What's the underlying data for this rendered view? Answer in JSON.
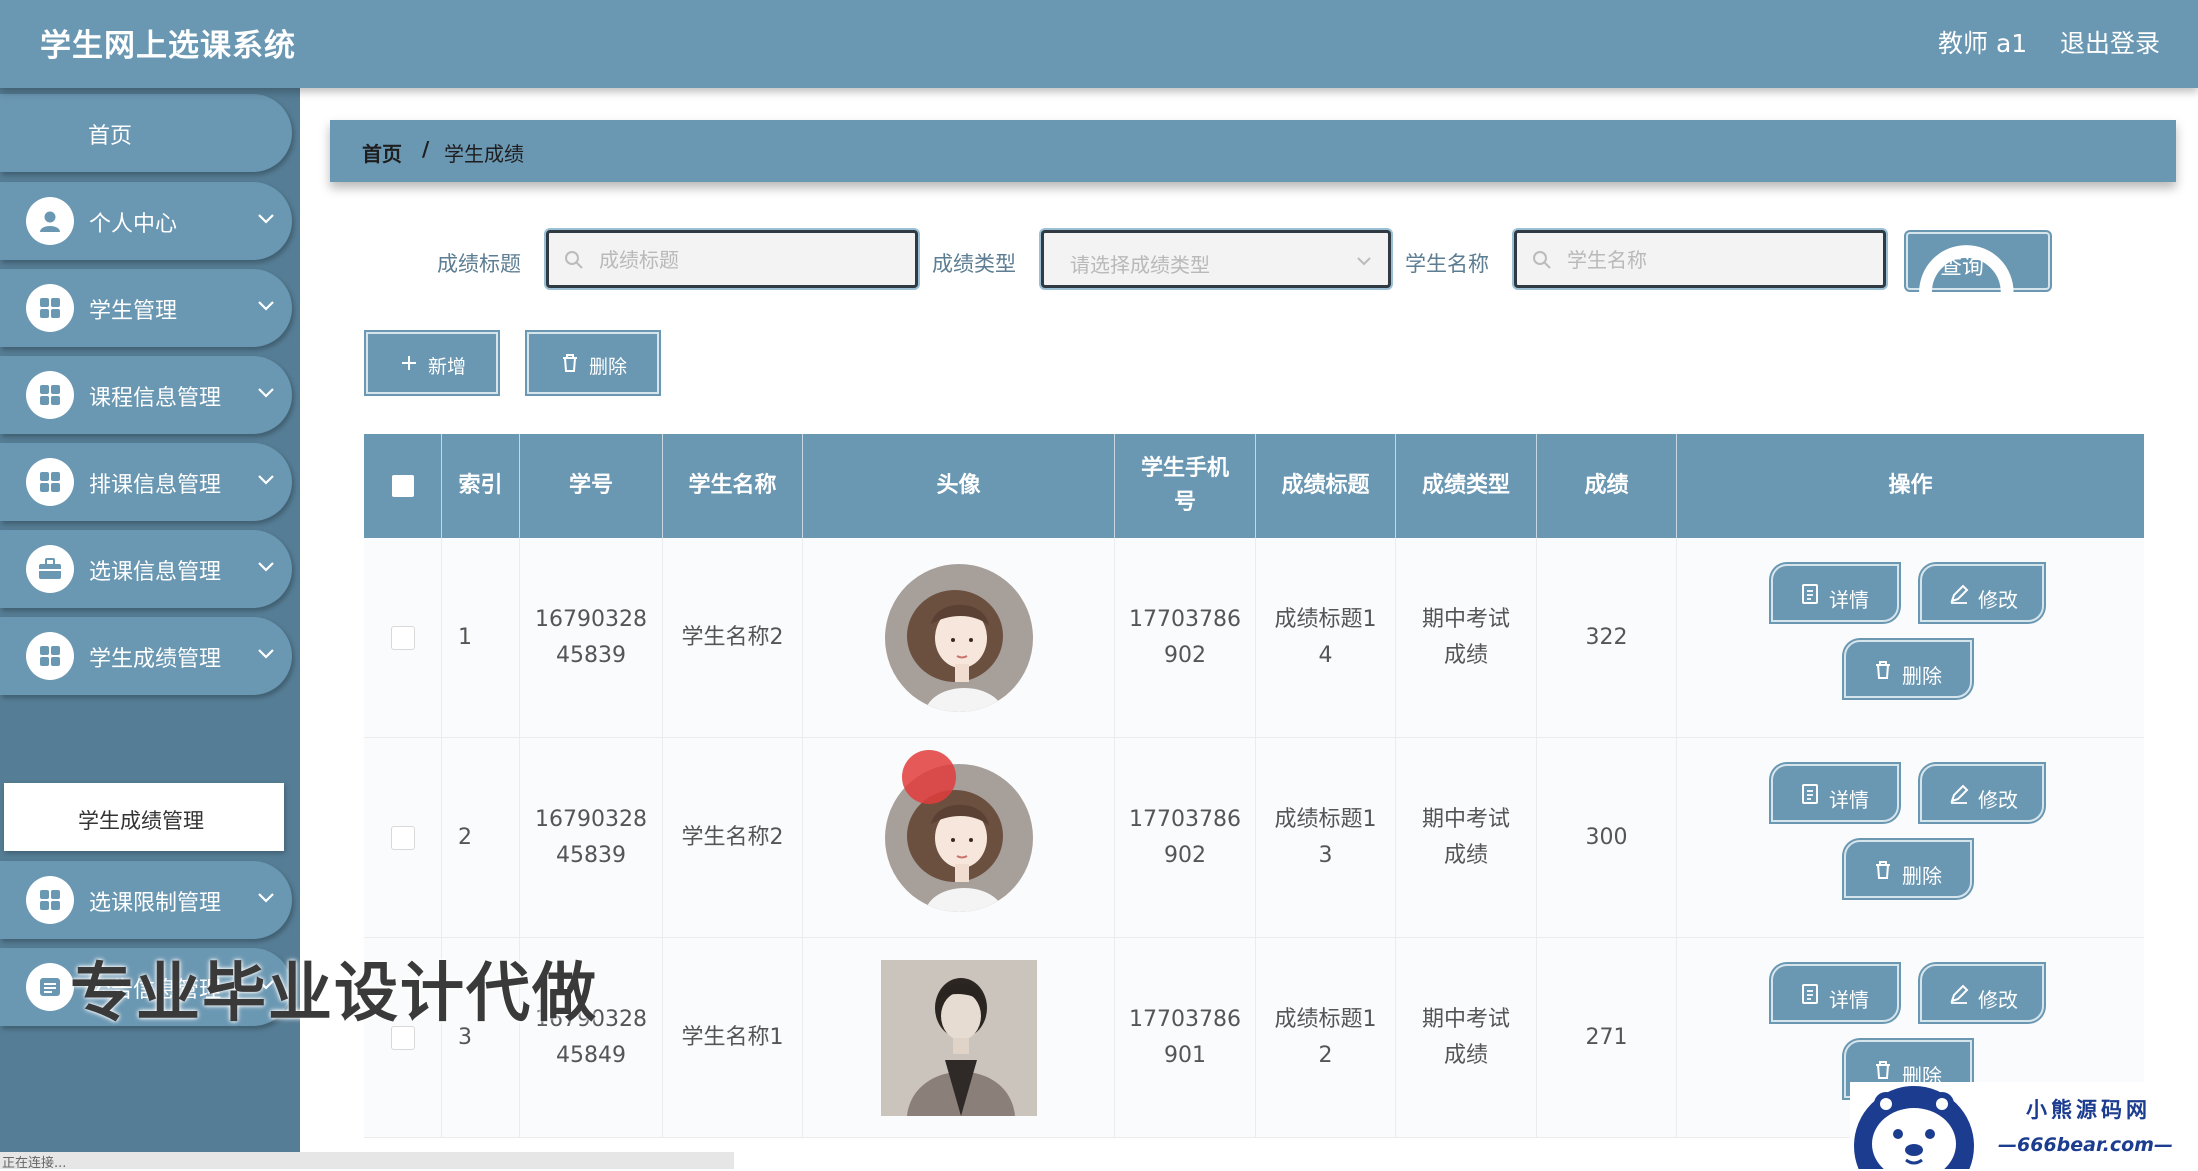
{
  "header": {
    "app_title": "学生网上选课系统",
    "user_label": "教师 a1",
    "logout_label": "退出登录"
  },
  "sidebar": {
    "home_label": "首页",
    "items": [
      {
        "label": "个人中心",
        "icon": "user-icon"
      },
      {
        "label": "学生管理",
        "icon": "grid-icon"
      },
      {
        "label": "课程信息管理",
        "icon": "grid-icon"
      },
      {
        "label": "排课信息管理",
        "icon": "grid-icon"
      },
      {
        "label": "选课信息管理",
        "icon": "briefcase-icon"
      },
      {
        "label": "学生成绩管理",
        "icon": "grid-icon"
      },
      {
        "label": "选课限制管理",
        "icon": "grid-icon"
      },
      {
        "label": "公告信息管理",
        "icon": "list-icon"
      }
    ],
    "active_submenu": "学生成绩管理"
  },
  "breadcrumb": {
    "home": "首页",
    "separator": "/",
    "current": "学生成绩"
  },
  "filters": {
    "score_title_label": "成绩标题",
    "score_title_placeholder": "成绩标题",
    "score_type_label": "成绩类型",
    "score_type_placeholder": "请选择成绩类型",
    "student_name_label": "学生名称",
    "student_name_placeholder": "学生名称",
    "query_label": "查询"
  },
  "actions": {
    "add_label": "新增",
    "delete_label": "删除"
  },
  "table": {
    "columns": [
      "",
      "索引",
      "学号",
      "学生名称",
      "头像",
      "学生手机号",
      "成绩标题",
      "成绩类型",
      "成绩",
      "操作"
    ],
    "rows": [
      {
        "index": "1",
        "student_no_1": "16790328",
        "student_no_2": "45839",
        "name": "学生名称2",
        "avatar": "female-avatar",
        "phone_1": "17703786",
        "phone_2": "902",
        "title_1": "成绩标题1",
        "title_2": "4",
        "type_1": "期中考试",
        "type_2": "成绩",
        "score": "322"
      },
      {
        "index": "2",
        "student_no_1": "16790328",
        "student_no_2": "45839",
        "name": "学生名称2",
        "avatar": "female-avatar",
        "phone_1": "17703786",
        "phone_2": "902",
        "title_1": "成绩标题1",
        "title_2": "3",
        "type_1": "期中考试",
        "type_2": "成绩",
        "score": "300"
      },
      {
        "index": "3",
        "student_no_1": "16790328",
        "student_no_2": "45849",
        "name": "学生名称1",
        "avatar": "male-photo",
        "phone_1": "17703786",
        "phone_2": "901",
        "title_1": "成绩标题1",
        "title_2": "2",
        "type_1": "期中考试",
        "type_2": "成绩",
        "score": "271"
      }
    ],
    "op_labels": {
      "detail": "详情",
      "edit": "修改",
      "delete": "删除"
    }
  },
  "overlays": {
    "watermark_text": "专业毕业设计代做",
    "status_text": "正在连接...",
    "logo_cn": "小熊源码网",
    "logo_url": "—666bear.com—"
  },
  "colors": {
    "primary": "#6a97b2",
    "sidebar_bg": "#557d95",
    "header_text": "#ffffff",
    "logo_blue": "#1c3d8f"
  }
}
